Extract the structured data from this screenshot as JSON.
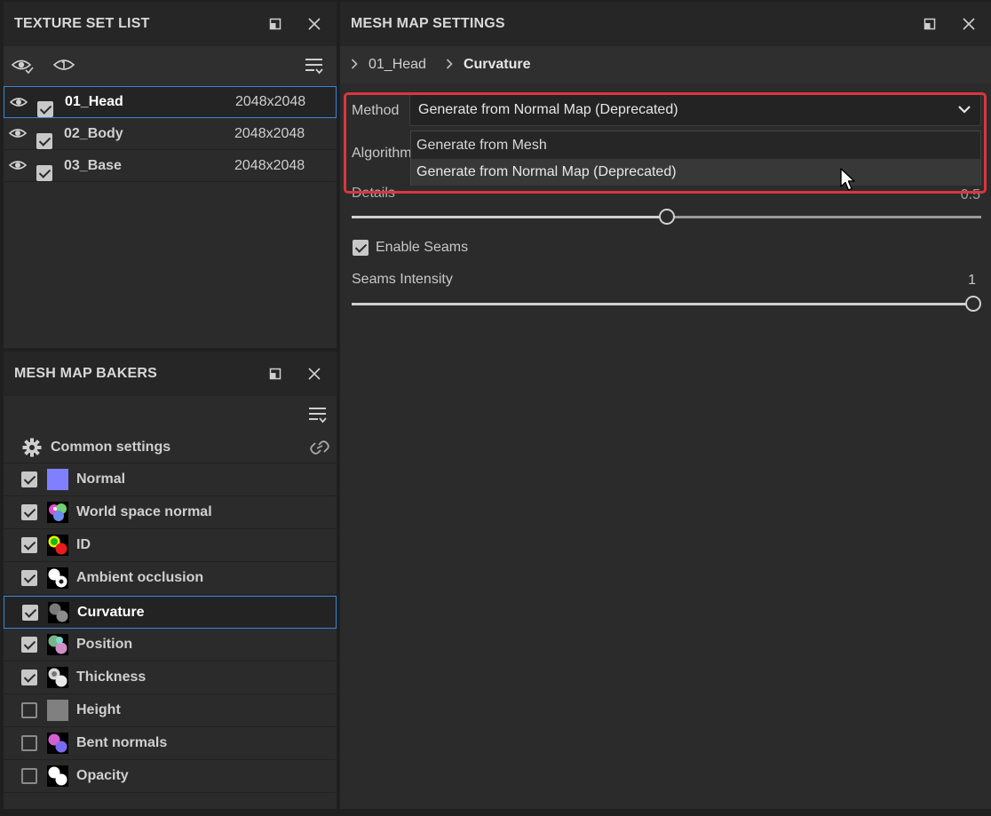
{
  "texture_set_list": {
    "title": "TEXTURE SET LIST",
    "rows": [
      {
        "name": "01_Head",
        "resolution": "2048x2048",
        "selected": true
      },
      {
        "name": "02_Body",
        "resolution": "2048x2048",
        "selected": false
      },
      {
        "name": "03_Base",
        "resolution": "2048x2048",
        "selected": false
      }
    ]
  },
  "mesh_map_bakers": {
    "title": "MESH MAP BAKERS",
    "common_settings": "Common settings",
    "bakers": [
      {
        "label": "Normal",
        "checked": true,
        "icon": "normal-map-icon"
      },
      {
        "label": "World space normal",
        "checked": true,
        "icon": "world-space-normal-icon"
      },
      {
        "label": "ID",
        "checked": true,
        "icon": "id-map-icon"
      },
      {
        "label": "Ambient occlusion",
        "checked": true,
        "icon": "ambient-occlusion-icon"
      },
      {
        "label": "Curvature",
        "checked": true,
        "icon": "curvature-icon",
        "selected": true
      },
      {
        "label": "Position",
        "checked": true,
        "icon": "position-icon"
      },
      {
        "label": "Thickness",
        "checked": true,
        "icon": "thickness-icon"
      },
      {
        "label": "Height",
        "checked": false,
        "icon": "height-icon"
      },
      {
        "label": "Bent normals",
        "checked": false,
        "icon": "bent-normals-icon"
      },
      {
        "label": "Opacity",
        "checked": false,
        "icon": "opacity-icon"
      }
    ]
  },
  "mesh_map_settings": {
    "title": "MESH MAP SETTINGS",
    "breadcrumb": {
      "set": "01_Head",
      "baker": "Curvature"
    },
    "method_label": "Method",
    "method_value": "Generate from Normal Map (Deprecated)",
    "method_options": [
      "Generate from Mesh",
      "Generate from Normal Map (Deprecated)"
    ],
    "algorithm_label": "Algorithm",
    "details_label": "Details",
    "details_value": "0.5",
    "details_level": 0.5,
    "enable_seams_label": "Enable Seams",
    "enable_seams": true,
    "seams_intensity_label": "Seams Intensity",
    "seams_intensity_value": "1",
    "seams_intensity_level": 1.0
  },
  "colors": {
    "selection_border": "#3a86d6",
    "highlight_red": "#d9363e",
    "normal_swatch": "#8080ff",
    "height_swatch": "#808080"
  }
}
